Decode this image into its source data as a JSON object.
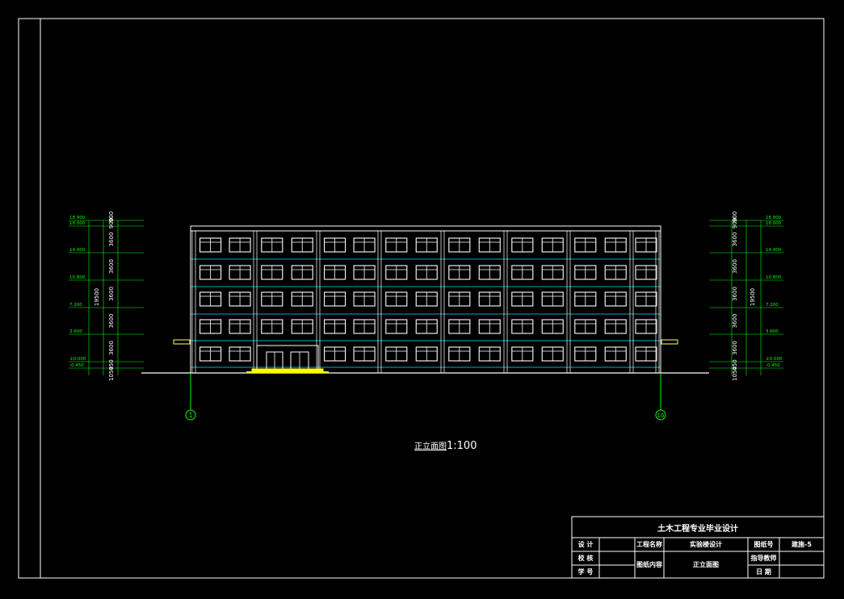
{
  "drawing": {
    "caption_name": "正立面图",
    "caption_scale": "1:100",
    "axis_left": "1",
    "axis_right": "10",
    "elevations_left": [
      "18.900",
      "18.000",
      "14.400",
      "10.800",
      "7.200",
      "3.600",
      "±0.000",
      "-0.450"
    ],
    "elevations_right": [
      "18.900",
      "18.000",
      "14.400",
      "10.800",
      "7.200",
      "3.600",
      "±0.000",
      "-0.450"
    ],
    "dims_outer": [
      "1050",
      "450",
      "3600",
      "3600",
      "3600",
      "3600",
      "3600",
      "900",
      "900"
    ],
    "dims_total": "19500",
    "colors": {
      "background": "#000000",
      "frame": "#ffffff",
      "building": "#ffffff",
      "floor_lines": "#00e5ff",
      "dimension": "#00ff00",
      "ground": "#ffffff",
      "entrance": "#ffff00",
      "axis_marker": "#00ff00"
    }
  },
  "title_block": {
    "header": "土木工程专业毕业设计",
    "row1": {
      "k1": "设 计",
      "v1": "",
      "k2": "工程名称",
      "v2": "实验楼设计",
      "k3": "图纸号",
      "v3": "建施-5"
    },
    "row2": {
      "k1": "校 核",
      "v1": "",
      "k2": "图纸内容",
      "v2": "正立面图",
      "k3": "指导教师",
      "v3": ""
    },
    "row3": {
      "k1": "学 号",
      "v1": "",
      "k3": "日 期",
      "v3": ""
    }
  }
}
